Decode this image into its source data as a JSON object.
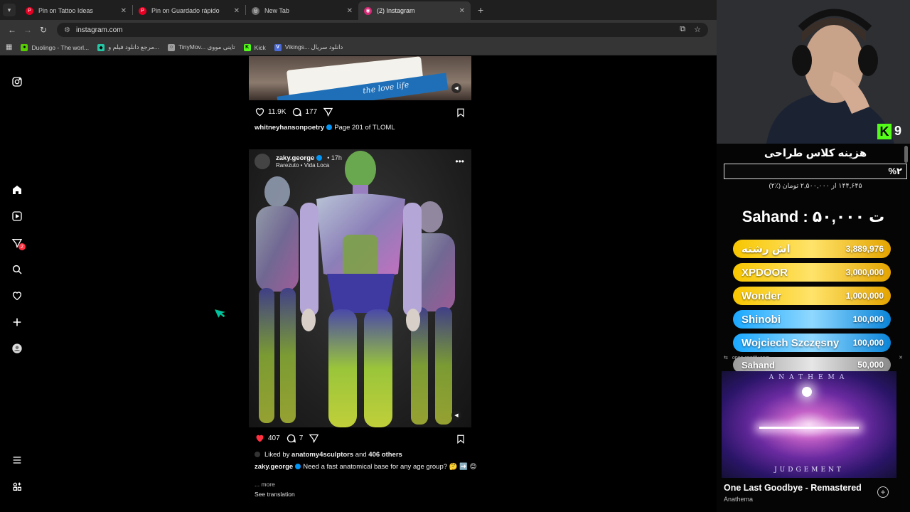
{
  "tabs": [
    {
      "title": "Pin on Tattoo Ideas",
      "icon": "pinterest-icon",
      "color": "#e60023"
    },
    {
      "title": "Pin on Guardado rápido",
      "icon": "pinterest-icon",
      "color": "#e60023"
    },
    {
      "title": "New Tab",
      "icon": "globe-icon",
      "color": "#8a8a8a"
    },
    {
      "title": "(2) Instagram",
      "icon": "instagram-icon",
      "color": "#d62976",
      "active": true
    }
  ],
  "address": "instagram.com",
  "bookmarks": [
    {
      "label": "Duolingo - The worl...",
      "color": "#58cc02"
    },
    {
      "label": "مرجع دانلود فیلم و...",
      "color": "#26c6a5"
    },
    {
      "label": "TinyMov... تاینی مووی",
      "color": "#9e9e9e"
    },
    {
      "label": "Kick",
      "color": "#53fc18"
    },
    {
      "label": "Vikings... دانلود سریال",
      "color": "#4b6bd8"
    }
  ],
  "post1": {
    "likes": "11.9K",
    "comments": "177",
    "username": "whitneyhansonpoetry",
    "caption": "Page 201 of TLOML",
    "book_text": "the love life"
  },
  "post2": {
    "username": "zaky.george",
    "time": "17h",
    "audio": "Rarezuto • Vida Loca",
    "likes": "407",
    "comments": "7",
    "liked_by_prefix": "Liked by",
    "liked_by_user": "anatomy4sculptors",
    "liked_by_and": "and",
    "liked_by_others": "406 others",
    "caption": "Need a fast anatomical base for any age group? 🤔 ➡️ 😊",
    "more": "... more",
    "see_translation": "See translation"
  },
  "notifications_badge": "2",
  "stream": {
    "kick_letter": "K",
    "viewer_count": "9",
    "goal_title": "هزینه کلاس طراحی",
    "goal_percent": "%۲",
    "goal_sub": "۱۴۴,۶۴۵ از ۲,۵۰۰,۰۰۰ تومان (٪۲)",
    "top_donor": "Sahand : ۵۰,۰۰۰ ت",
    "leaderboard": [
      {
        "name": "اش رشته",
        "amount": "3,889,976",
        "tier": "gold"
      },
      {
        "name": "XPDOOR",
        "amount": "3,000,000",
        "tier": "gold"
      },
      {
        "name": "Wonder",
        "amount": "1,000,000",
        "tier": "gold"
      },
      {
        "name": "Shinobi",
        "amount": "100,000",
        "tier": "blue"
      },
      {
        "name": "Wojciech Szczęsny",
        "amount": "100,000",
        "tier": "blue"
      },
      {
        "name": "Sahand",
        "amount": "50,000",
        "tier": "silver"
      }
    ],
    "spotify_url": "open.spotify.com",
    "album_top": "ANATHEMA",
    "album_bottom": "JUDGEMENT",
    "track": "One Last Goodbye - Remastered",
    "artist": "Anathema"
  }
}
